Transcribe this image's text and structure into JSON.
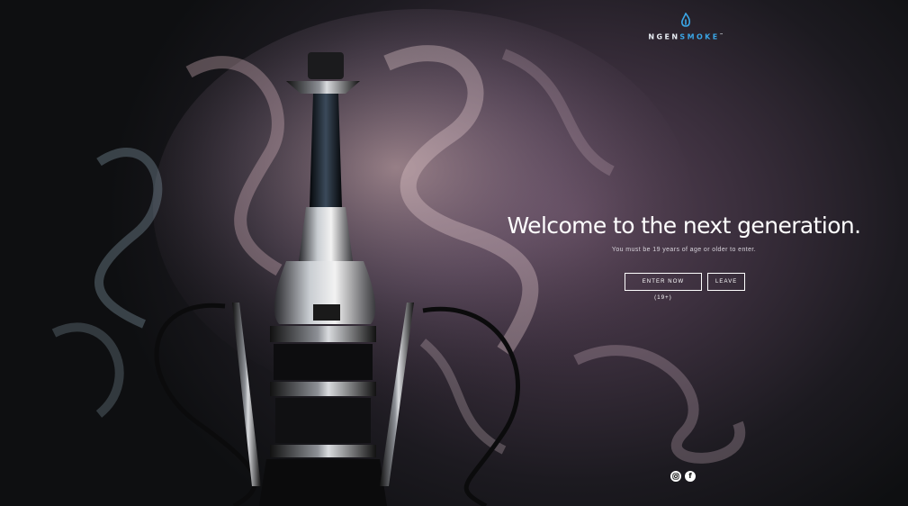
{
  "brand": {
    "name_part_a": "NGEN",
    "name_part_b": "SMOKE",
    "trademark": "™",
    "accent_color": "#3aa6e6"
  },
  "hero": {
    "title": "Welcome to the next generation.",
    "subtitle": "You must be 19 years of age or older to enter."
  },
  "actions": {
    "enter_label": "ENTER NOW (19+)",
    "leave_label": "LEAVE"
  },
  "social": {
    "icons": [
      "instagram-icon",
      "facebook-icon"
    ],
    "facebook_glyph": "f"
  },
  "background": {
    "image": "hookah-with-smoke"
  }
}
